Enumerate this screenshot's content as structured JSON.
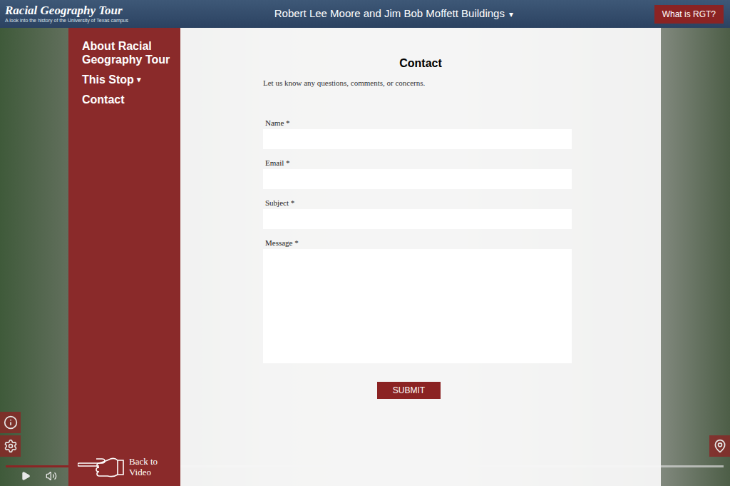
{
  "header": {
    "title": "Racial Geography Tour",
    "subtitle": "A look into the history of the University of Texas campus",
    "stop_menu": {
      "label": "Robert Lee Moore and Jim Bob Moffett Buildings",
      "caret": "▾"
    },
    "about_button": "What is RGT?"
  },
  "sidebar": {
    "items": [
      {
        "label": "About Racial Geography Tour",
        "has_menu": false
      },
      {
        "label": "This Stop",
        "has_menu": true
      },
      {
        "label": "Contact",
        "has_menu": false
      }
    ],
    "caret": "▾",
    "back_link": "Back to Video"
  },
  "form": {
    "title": "Contact",
    "description": "Let us know any questions, comments, or concerns.",
    "fields": [
      {
        "label": "Name *",
        "kind": "input",
        "value": ""
      },
      {
        "label": "Email *",
        "kind": "input",
        "value": ""
      },
      {
        "label": "Subject *",
        "kind": "input",
        "value": ""
      },
      {
        "label": "Message *",
        "kind": "textarea",
        "value": ""
      }
    ],
    "submit": "SUBMIT"
  },
  "player": {
    "playing": false,
    "muted": false,
    "level": 0.09
  }
}
